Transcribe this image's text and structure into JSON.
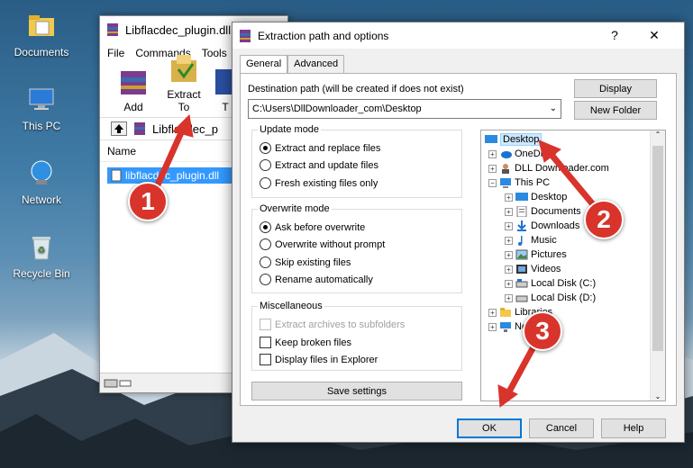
{
  "desktop": {
    "icons": [
      {
        "label": "Documents",
        "icon": "folder-icon"
      },
      {
        "label": "This PC",
        "icon": "computer-icon"
      },
      {
        "label": "Network",
        "icon": "network-icon"
      },
      {
        "label": "Recycle Bin",
        "icon": "recycle-bin-icon"
      }
    ]
  },
  "winrar": {
    "title": "Libflacdec_plugin.dll",
    "menu": [
      "File",
      "Commands",
      "Tools"
    ],
    "toolbar": [
      {
        "label": "Add",
        "icon": "add-archive-icon"
      },
      {
        "label": "Extract To",
        "icon": "extract-to-icon"
      },
      {
        "label": "T",
        "icon": "test-icon"
      }
    ],
    "path": "Libflacdec_p",
    "column_name": "Name",
    "selected_file": "libflacdec_plugin.dll"
  },
  "dialog": {
    "title": "Extraction path and options",
    "help_glyph": "?",
    "close_glyph": "✕",
    "tabs": [
      "General",
      "Advanced"
    ],
    "dest_label": "Destination path (will be created if does not exist)",
    "dest_value": "C:\\Users\\DllDownloader_com\\Desktop",
    "display_button": "Display",
    "new_folder_button": "New Folder",
    "update_mode": {
      "title": "Update mode",
      "options": [
        "Extract and replace files",
        "Extract and update files",
        "Fresh existing files only"
      ],
      "selected": 0
    },
    "overwrite_mode": {
      "title": "Overwrite mode",
      "options": [
        "Ask before overwrite",
        "Overwrite without prompt",
        "Skip existing files",
        "Rename automatically"
      ],
      "selected": 0
    },
    "misc": {
      "title": "Miscellaneous",
      "options": [
        {
          "label": "Extract archives to subfolders",
          "checked": false,
          "disabled": true
        },
        {
          "label": "Keep broken files",
          "checked": false,
          "disabled": false
        },
        {
          "label": "Display files in Explorer",
          "checked": false,
          "disabled": false
        }
      ]
    },
    "save_settings_button": "Save settings",
    "tree": [
      {
        "label": "Desktop",
        "level": 0,
        "expander": "",
        "icon": "desktop-icon",
        "selected": true
      },
      {
        "label": "OneDrive",
        "level": 1,
        "expander": "+",
        "icon": "onedrive-icon"
      },
      {
        "label": "DLL Downloader.com",
        "level": 1,
        "expander": "+",
        "icon": "user-icon"
      },
      {
        "label": "This PC",
        "level": 1,
        "expander": "−",
        "icon": "computer-icon"
      },
      {
        "label": "Desktop",
        "level": 2,
        "expander": "+",
        "icon": "desktop-icon"
      },
      {
        "label": "Documents",
        "level": 2,
        "expander": "+",
        "icon": "documents-icon"
      },
      {
        "label": "Downloads",
        "level": 2,
        "expander": "+",
        "icon": "downloads-icon"
      },
      {
        "label": "Music",
        "level": 2,
        "expander": "+",
        "icon": "music-icon"
      },
      {
        "label": "Pictures",
        "level": 2,
        "expander": "+",
        "icon": "pictures-icon"
      },
      {
        "label": "Videos",
        "level": 2,
        "expander": "+",
        "icon": "videos-icon"
      },
      {
        "label": "Local Disk (C:)",
        "level": 2,
        "expander": "+",
        "icon": "disk-icon"
      },
      {
        "label": "Local Disk (D:)",
        "level": 2,
        "expander": "+",
        "icon": "disk-icon"
      },
      {
        "label": "Libraries",
        "level": 1,
        "expander": "+",
        "icon": "libraries-icon"
      },
      {
        "label": "Network",
        "level": 1,
        "expander": "+",
        "icon": "network-icon"
      }
    ],
    "ok_button": "OK",
    "cancel_button": "Cancel",
    "help_button": "Help"
  },
  "annotations": [
    {
      "number": "1"
    },
    {
      "number": "2"
    },
    {
      "number": "3"
    }
  ],
  "colors": {
    "accent": "#3399ff",
    "marker": "#d8342b",
    "tree_selection": "#cce8ff"
  }
}
